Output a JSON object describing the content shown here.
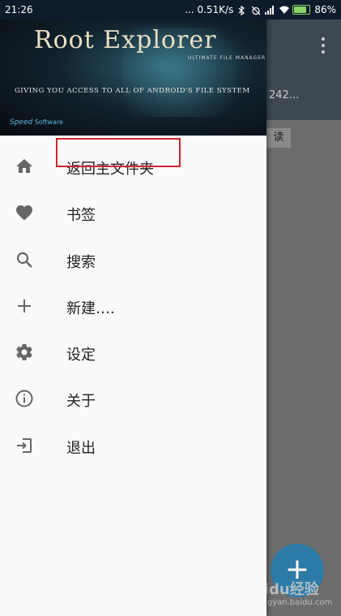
{
  "status_bar": {
    "time": "21:26",
    "network_speed": "... 0.51K/s",
    "battery": "86%"
  },
  "drawer": {
    "header": {
      "logo": "Root Explorer",
      "subtitle": "ULTIMATE FILE MANAGER",
      "tagline": "GIVING YOU ACCESS TO ALL OF ANDROID'S FILE SYSTEM",
      "brand_name": "Speed",
      "brand_suffix": "Software"
    },
    "items": [
      {
        "label": "返回主文件夹",
        "icon": "home-icon"
      },
      {
        "label": "书签",
        "icon": "heart-icon"
      },
      {
        "label": "搜索",
        "icon": "search-icon"
      },
      {
        "label": "新建….",
        "icon": "plus-icon"
      },
      {
        "label": "设定",
        "icon": "gear-icon"
      },
      {
        "label": "关于",
        "icon": "info-icon"
      },
      {
        "label": "退出",
        "icon": "exit-icon"
      }
    ]
  },
  "background": {
    "path_text": "242...",
    "chip_text": "读",
    "fab_label": "+"
  },
  "watermark": {
    "text": "Baidu经验",
    "url": "jingyan.baidu.com"
  },
  "colors": {
    "highlight_box": "#d0262b",
    "fab": "#2d7aa6",
    "icon": "#666666"
  }
}
